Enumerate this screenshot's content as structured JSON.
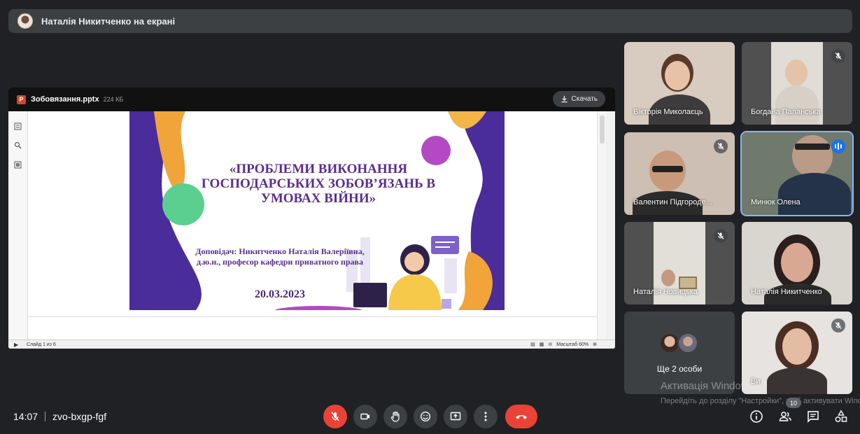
{
  "presenter_banner": {
    "text": "Наталія Никитченко на екрані"
  },
  "shared_file": {
    "name": "Зобовязання.pptx",
    "size": "224 КБ",
    "download_label": "Скачать",
    "status_slide": "Слайд 1 из 6",
    "status_zoom": "Масштаб 60%"
  },
  "slide": {
    "title": "«ПРОБЛЕМИ ВИКОНАННЯ ГОСПОДАРСЬКИХ ЗОБОВ’ЯЗАНЬ В УМОВАХ ВІЙНИ»",
    "speaker": "Доповідач: Никитченко Наталія Валеріївна, д.ю.н., професор кафедри приватного права",
    "date": "20.03.2023"
  },
  "participants": [
    {
      "name": "Вікторія Миколаєць",
      "muted": false
    },
    {
      "name": "Богдана Паланська",
      "muted": true
    },
    {
      "name": "Валентин Підгороде...",
      "muted": true
    },
    {
      "name": "Минюк Олена",
      "speaking": true
    },
    {
      "name": "Наталія Новицька",
      "muted": true
    },
    {
      "name": "Наталія Никитченко",
      "muted": false
    },
    {
      "name": "Ще 2 особи"
    },
    {
      "name": "Ви",
      "muted": true
    }
  ],
  "watermark": {
    "title": "Активація Windows",
    "subtitle": "Перейдіть до розділу \"Настройки\", щоб активувати Windows."
  },
  "meeting": {
    "time": "14:07",
    "code": "zvo-bxgp-fgf",
    "participant_count": "10"
  },
  "colors": {
    "end_call": "#ea4335",
    "mic_off": "#ea4335",
    "speaking": "#1a73e8",
    "slide_purple": "#5b2d8c"
  },
  "icons": [
    "mic-off-icon",
    "camera-icon",
    "raise-hand-icon",
    "emoji-icon",
    "present-icon",
    "more-options-icon",
    "end-call-icon",
    "info-icon",
    "people-icon",
    "chat-icon",
    "activities-icon",
    "download-icon"
  ]
}
